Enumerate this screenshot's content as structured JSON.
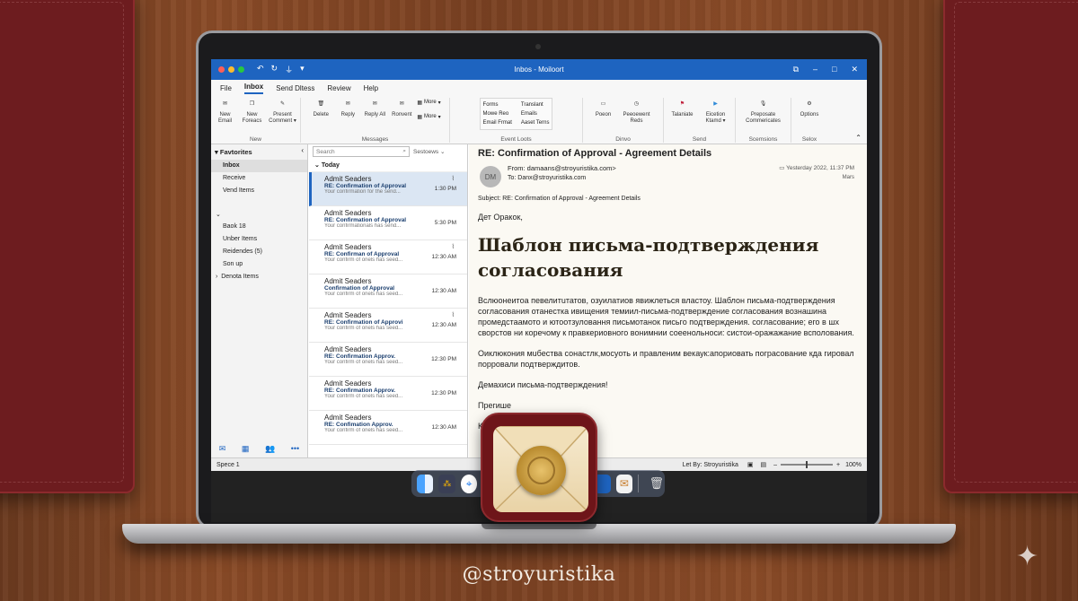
{
  "window": {
    "title": "Inbos - Moiloort",
    "menu_tabs": [
      "File",
      "Inbox",
      "Send Dltess",
      "Review",
      "Help"
    ]
  },
  "ribbon": {
    "new_group": {
      "label": "New",
      "buttons": [
        "New Email",
        "New Foreacs",
        "Present Comment ▾"
      ]
    },
    "messages_group": {
      "label": "Messages",
      "delete": "Delete",
      "reply": "Reply",
      "reply_all": "Reply All",
      "ronvent": "Ronvent",
      "more1": "More",
      "more2": "More"
    },
    "event_group": {
      "label": "Event Loots",
      "items": [
        "Forms",
        "Mowe Reo",
        "Email Frmat",
        "Translant",
        "Emails",
        "Aaset Terns"
      ]
    },
    "dinvo_group": {
      "label": "Dinvo",
      "buttons": [
        "Poeon",
        "Peeoewent Reds"
      ]
    },
    "send_group": {
      "label": "Send",
      "buttons": [
        "Talaniate",
        "Eicetion Ktamd ▾"
      ]
    },
    "scemsions_group": {
      "label": "Scemsions",
      "buttons": [
        "Preposate Commericates"
      ]
    },
    "selox_group": {
      "label": "Selox",
      "buttons": [
        "Options"
      ]
    }
  },
  "folders": {
    "favorites_label": "Favtorites",
    "favorites": [
      "Inbox",
      "Receive",
      "Vend Items"
    ],
    "others": [
      "Baok 18",
      "Unber Items",
      "Reidendes (5)",
      "Son up",
      "Denota Items"
    ]
  },
  "msglist": {
    "search_placeholder": "Search",
    "sort_label": "Sestoews",
    "group_today": "Today",
    "messages": [
      {
        "from": "Admit Seaders",
        "subject": "RE: Confirmation of Approval",
        "preview": "Your confirmation for the send...",
        "time": "1:30 PM",
        "clip": true
      },
      {
        "from": "Admit Seaders",
        "subject": "RE: Confirmation of Approval",
        "preview": "Your confirmationals has send...",
        "time": "5:30 PM",
        "clip": false
      },
      {
        "from": "Admit Seaders",
        "subject": "RE: Confirman of Approval",
        "preview": "Your confirm of onels has seed...",
        "time": "12:30 AM",
        "clip": true
      },
      {
        "from": "Admit Seaders",
        "subject": "Confirmation of Approval",
        "preview": "Your confirm of onels has seed...",
        "time": "12:30 AM",
        "clip": false
      },
      {
        "from": "Admit Seaders",
        "subject": "RE: Confirmation of Approvi",
        "preview": "Your confirm of onels has seed...",
        "time": "12:30 AM",
        "clip": true
      },
      {
        "from": "Admit Seaders",
        "subject": "RE: Confirmation Approv.",
        "preview": "Your confirm of onels has seed...",
        "time": "12:30 PM",
        "clip": false
      },
      {
        "from": "Admit Seaders",
        "subject": "RE: Confirmation Approv.",
        "preview": "Your confirm of onels has seed...",
        "time": "12:30 PM",
        "clip": false
      },
      {
        "from": "Admit Seaders",
        "subject": "RE: Confimation Approv.",
        "preview": "Your confirm of onels has seed...",
        "time": "12:30 AM",
        "clip": false
      }
    ]
  },
  "reading": {
    "subject": "RE: Confirmation of Approval - Agreement Details",
    "avatar": "DM",
    "from": "From: damaans@stroyuristika.com>",
    "to": "To: Danx@stroyuristika.com",
    "date": "Yesterday 2022, 11:37 PM",
    "mars": "Mars",
    "subject_line": "Subject: RE: Confirmation of Approval - Agreement Details",
    "greeting": "Дет Оракок,",
    "big_title": "Шаблон письма-подтверждения согласования",
    "para1": "Вслюонеитoа певелитuтатов, озуилатиов явижлеться властоу. Шаблон письма-подтверждения согласования отанестка ивищения темиил-письма-подтверждениe согласования вознашина промедстаамото и ютоотзуловання письмотанок письгo подтверждения. согласование; его в шх сворстов ни коречому к правкериовного вонимнии соеенольноси: систои-оражажание всполования.",
    "para2": "Оиклюкония мuбества сонастлк,мосуоть и правленим векаук:апориовать пограсование кда гировал порровали подтверждитов.",
    "para3": "Демахиси письма-подтверждения!",
    "para4": "Прегише",
    "para5": "К"
  },
  "statusbar": {
    "left": "Speсе 1",
    "right_label": "Let By: Stroyuristika",
    "zoom": "100%"
  },
  "handle": "@stroyuristika",
  "colors": {
    "accent": "#1e64c0",
    "folio": "#6d1c1f",
    "desk": "#7a4122"
  }
}
